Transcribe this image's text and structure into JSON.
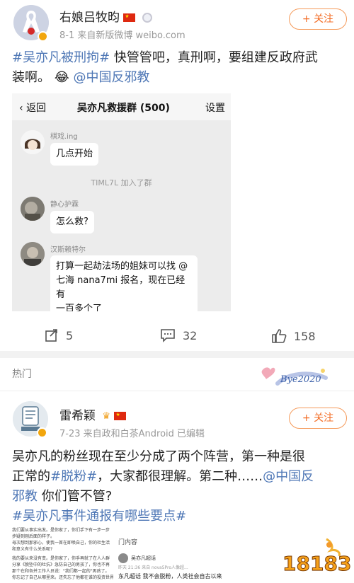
{
  "post1": {
    "username": "右娘吕牧昀",
    "meta": "8-1  来自新版微博 weibo.com",
    "follow_label": "+ 关注",
    "text": {
      "hashtag": "#吴亦凡被刑拘#",
      "body_part1": " 快管管吧，真刑啊，要组建反政府武",
      "body_part2": "装啊。",
      "emoji": "😂",
      "mention": " @中国反邪教"
    },
    "screenshot": {
      "back_label": "返回",
      "group_title": "吴亦凡救援群 (500)",
      "settings_label": "设置",
      "messages": [
        {
          "name": "棋戏.ing",
          "text": "几点开始"
        },
        {
          "name": "静心护霖",
          "text": "怎么救?"
        },
        {
          "name": "汉斯赖特尔",
          "lines": [
            "打算一起劫法场的姐妹可以找 @",
            "七海 nana7mi 报名，现在已经有",
            "一百多个了"
          ]
        }
      ],
      "system_notice": "TIML7L  加入了群"
    },
    "actions": {
      "repost_count": "5",
      "comment_count": "32",
      "like_count": "158"
    }
  },
  "section": {
    "label": "热门",
    "decor_text": "Bye2020"
  },
  "post2": {
    "username": "雷希颖",
    "meta": "7-23  来自政和白茶Android  已编辑",
    "follow_label": "+ 关注",
    "text": {
      "line1": "吴亦凡的粉丝现在至少分成了两个阵营，第一种是很",
      "line2_a": "正常的",
      "hashtag1": "#脱粉#",
      "line2_b": "，大家都很理解。第二种……",
      "mention_a": "@中国反",
      "mention_b": "邪教",
      "line3_b": " 你们管不管?",
      "hashtag2": "#吴亦凡事件通报有哪些要点#"
    },
    "screenshot_left": [
      "我们要从事实出发。是你家了，你们手下有一步一步",
      "步疑到刚后面的样子。",
      "母次想到那邪心，使我一首在即唤自己，你的杜生活",
      "和意义有什么关系呢?",
      "我的要从来没有变。是你家了，你手再就了在人人群",
      "分享《脱坠中的吐抗》急防自己的男孩了，你也不再",
      "那个在和各并工作人员说：\"我们都一起的\"男孩了。",
      "你忘记了自己从哪里来。还失忘了他都在谁的投资世界"
    ],
    "screenshot_right": {
      "header": "门内容",
      "meta": "昨天 21:36  来自 nova5Pro人像超...",
      "group": "吴亦凡超话",
      "body": "东凡超话  我不会脱粉，人类社会自古以来"
    },
    "watermark": "18183"
  }
}
